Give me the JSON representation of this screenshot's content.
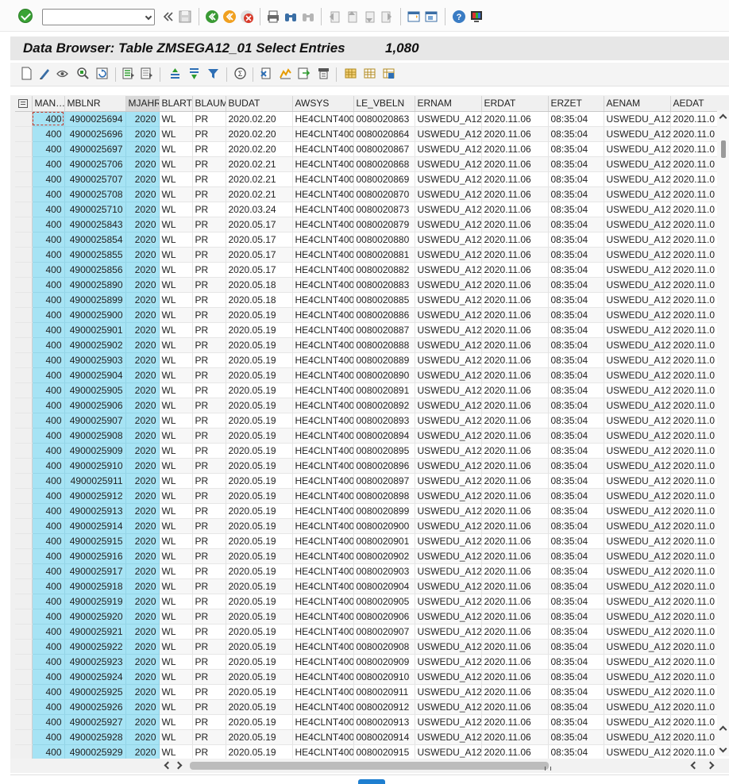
{
  "command_field": {
    "value": ""
  },
  "toolbar_icons": [
    "enter-icon",
    "back-icon",
    "save-icon",
    "back-green-icon",
    "exit-icon",
    "cancel-icon",
    "print-icon",
    "find-icon",
    "find-next-icon",
    "first-page-icon",
    "previous-page-icon",
    "next-page-icon",
    "last-page-icon",
    "create-session-icon",
    "shortcut-icon",
    "help-icon",
    "customize-layout-icon"
  ],
  "title": {
    "text": "Data Browser: Table ZMSEGA12_01 Select Entries",
    "count": "1,080"
  },
  "columns": [
    "MAN…",
    "MBLNR",
    "MJAHR",
    "BLART",
    "BLAUM",
    "BUDAT",
    "AWSYS",
    "LE_VBELN",
    "ERNAM",
    "ERDAT",
    "ERZET",
    "AENAM",
    "AEDAT"
  ],
  "rows": [
    {
      "man": "400",
      "mblnr": "4900025694",
      "mjahr": "2020",
      "blart": "WL",
      "blaum": "PR",
      "budat": "2020.02.20",
      "awsys": "HE4CLNT400",
      "le_vbeln": "0080020863",
      "ernam": "USWEDU_A12",
      "erdat": "2020.11.06",
      "erzet": "08:35:04",
      "aenam": "USWEDU_A12",
      "aedat": "2020.11.0"
    },
    {
      "man": "400",
      "mblnr": "4900025696",
      "mjahr": "2020",
      "blart": "WL",
      "blaum": "PR",
      "budat": "2020.02.20",
      "awsys": "HE4CLNT400",
      "le_vbeln": "0080020864",
      "ernam": "USWEDU_A12",
      "erdat": "2020.11.06",
      "erzet": "08:35:04",
      "aenam": "USWEDU_A12",
      "aedat": "2020.11.0"
    },
    {
      "man": "400",
      "mblnr": "4900025697",
      "mjahr": "2020",
      "blart": "WL",
      "blaum": "PR",
      "budat": "2020.02.20",
      "awsys": "HE4CLNT400",
      "le_vbeln": "0080020867",
      "ernam": "USWEDU_A12",
      "erdat": "2020.11.06",
      "erzet": "08:35:04",
      "aenam": "USWEDU_A12",
      "aedat": "2020.11.0"
    },
    {
      "man": "400",
      "mblnr": "4900025706",
      "mjahr": "2020",
      "blart": "WL",
      "blaum": "PR",
      "budat": "2020.02.21",
      "awsys": "HE4CLNT400",
      "le_vbeln": "0080020868",
      "ernam": "USWEDU_A12",
      "erdat": "2020.11.06",
      "erzet": "08:35:04",
      "aenam": "USWEDU_A12",
      "aedat": "2020.11.0"
    },
    {
      "man": "400",
      "mblnr": "4900025707",
      "mjahr": "2020",
      "blart": "WL",
      "blaum": "PR",
      "budat": "2020.02.21",
      "awsys": "HE4CLNT400",
      "le_vbeln": "0080020869",
      "ernam": "USWEDU_A12",
      "erdat": "2020.11.06",
      "erzet": "08:35:04",
      "aenam": "USWEDU_A12",
      "aedat": "2020.11.0"
    },
    {
      "man": "400",
      "mblnr": "4900025708",
      "mjahr": "2020",
      "blart": "WL",
      "blaum": "PR",
      "budat": "2020.02.21",
      "awsys": "HE4CLNT400",
      "le_vbeln": "0080020870",
      "ernam": "USWEDU_A12",
      "erdat": "2020.11.06",
      "erzet": "08:35:04",
      "aenam": "USWEDU_A12",
      "aedat": "2020.11.0"
    },
    {
      "man": "400",
      "mblnr": "4900025710",
      "mjahr": "2020",
      "blart": "WL",
      "blaum": "PR",
      "budat": "2020.03.24",
      "awsys": "HE4CLNT400",
      "le_vbeln": "0080020873",
      "ernam": "USWEDU_A12",
      "erdat": "2020.11.06",
      "erzet": "08:35:04",
      "aenam": "USWEDU_A12",
      "aedat": "2020.11.0"
    },
    {
      "man": "400",
      "mblnr": "4900025843",
      "mjahr": "2020",
      "blart": "WL",
      "blaum": "PR",
      "budat": "2020.05.17",
      "awsys": "HE4CLNT400",
      "le_vbeln": "0080020879",
      "ernam": "USWEDU_A12",
      "erdat": "2020.11.06",
      "erzet": "08:35:04",
      "aenam": "USWEDU_A12",
      "aedat": "2020.11.0"
    },
    {
      "man": "400",
      "mblnr": "4900025854",
      "mjahr": "2020",
      "blart": "WL",
      "blaum": "PR",
      "budat": "2020.05.17",
      "awsys": "HE4CLNT400",
      "le_vbeln": "0080020880",
      "ernam": "USWEDU_A12",
      "erdat": "2020.11.06",
      "erzet": "08:35:04",
      "aenam": "USWEDU_A12",
      "aedat": "2020.11.0"
    },
    {
      "man": "400",
      "mblnr": "4900025855",
      "mjahr": "2020",
      "blart": "WL",
      "blaum": "PR",
      "budat": "2020.05.17",
      "awsys": "HE4CLNT400",
      "le_vbeln": "0080020881",
      "ernam": "USWEDU_A12",
      "erdat": "2020.11.06",
      "erzet": "08:35:04",
      "aenam": "USWEDU_A12",
      "aedat": "2020.11.0"
    },
    {
      "man": "400",
      "mblnr": "4900025856",
      "mjahr": "2020",
      "blart": "WL",
      "blaum": "PR",
      "budat": "2020.05.17",
      "awsys": "HE4CLNT400",
      "le_vbeln": "0080020882",
      "ernam": "USWEDU_A12",
      "erdat": "2020.11.06",
      "erzet": "08:35:04",
      "aenam": "USWEDU_A12",
      "aedat": "2020.11.0"
    },
    {
      "man": "400",
      "mblnr": "4900025890",
      "mjahr": "2020",
      "blart": "WL",
      "blaum": "PR",
      "budat": "2020.05.18",
      "awsys": "HE4CLNT400",
      "le_vbeln": "0080020883",
      "ernam": "USWEDU_A12",
      "erdat": "2020.11.06",
      "erzet": "08:35:04",
      "aenam": "USWEDU_A12",
      "aedat": "2020.11.0"
    },
    {
      "man": "400",
      "mblnr": "4900025899",
      "mjahr": "2020",
      "blart": "WL",
      "blaum": "PR",
      "budat": "2020.05.18",
      "awsys": "HE4CLNT400",
      "le_vbeln": "0080020885",
      "ernam": "USWEDU_A12",
      "erdat": "2020.11.06",
      "erzet": "08:35:04",
      "aenam": "USWEDU_A12",
      "aedat": "2020.11.0"
    },
    {
      "man": "400",
      "mblnr": "4900025900",
      "mjahr": "2020",
      "blart": "WL",
      "blaum": "PR",
      "budat": "2020.05.19",
      "awsys": "HE4CLNT400",
      "le_vbeln": "0080020886",
      "ernam": "USWEDU_A12",
      "erdat": "2020.11.06",
      "erzet": "08:35:04",
      "aenam": "USWEDU_A12",
      "aedat": "2020.11.0"
    },
    {
      "man": "400",
      "mblnr": "4900025901",
      "mjahr": "2020",
      "blart": "WL",
      "blaum": "PR",
      "budat": "2020.05.19",
      "awsys": "HE4CLNT400",
      "le_vbeln": "0080020887",
      "ernam": "USWEDU_A12",
      "erdat": "2020.11.06",
      "erzet": "08:35:04",
      "aenam": "USWEDU_A12",
      "aedat": "2020.11.0"
    },
    {
      "man": "400",
      "mblnr": "4900025902",
      "mjahr": "2020",
      "blart": "WL",
      "blaum": "PR",
      "budat": "2020.05.19",
      "awsys": "HE4CLNT400",
      "le_vbeln": "0080020888",
      "ernam": "USWEDU_A12",
      "erdat": "2020.11.06",
      "erzet": "08:35:04",
      "aenam": "USWEDU_A12",
      "aedat": "2020.11.0"
    },
    {
      "man": "400",
      "mblnr": "4900025903",
      "mjahr": "2020",
      "blart": "WL",
      "blaum": "PR",
      "budat": "2020.05.19",
      "awsys": "HE4CLNT400",
      "le_vbeln": "0080020889",
      "ernam": "USWEDU_A12",
      "erdat": "2020.11.06",
      "erzet": "08:35:04",
      "aenam": "USWEDU_A12",
      "aedat": "2020.11.0"
    },
    {
      "man": "400",
      "mblnr": "4900025904",
      "mjahr": "2020",
      "blart": "WL",
      "blaum": "PR",
      "budat": "2020.05.19",
      "awsys": "HE4CLNT400",
      "le_vbeln": "0080020890",
      "ernam": "USWEDU_A12",
      "erdat": "2020.11.06",
      "erzet": "08:35:04",
      "aenam": "USWEDU_A12",
      "aedat": "2020.11.0"
    },
    {
      "man": "400",
      "mblnr": "4900025905",
      "mjahr": "2020",
      "blart": "WL",
      "blaum": "PR",
      "budat": "2020.05.19",
      "awsys": "HE4CLNT400",
      "le_vbeln": "0080020891",
      "ernam": "USWEDU_A12",
      "erdat": "2020.11.06",
      "erzet": "08:35:04",
      "aenam": "USWEDU_A12",
      "aedat": "2020.11.0"
    },
    {
      "man": "400",
      "mblnr": "4900025906",
      "mjahr": "2020",
      "blart": "WL",
      "blaum": "PR",
      "budat": "2020.05.19",
      "awsys": "HE4CLNT400",
      "le_vbeln": "0080020892",
      "ernam": "USWEDU_A12",
      "erdat": "2020.11.06",
      "erzet": "08:35:04",
      "aenam": "USWEDU_A12",
      "aedat": "2020.11.0"
    },
    {
      "man": "400",
      "mblnr": "4900025907",
      "mjahr": "2020",
      "blart": "WL",
      "blaum": "PR",
      "budat": "2020.05.19",
      "awsys": "HE4CLNT400",
      "le_vbeln": "0080020893",
      "ernam": "USWEDU_A12",
      "erdat": "2020.11.06",
      "erzet": "08:35:04",
      "aenam": "USWEDU_A12",
      "aedat": "2020.11.0"
    },
    {
      "man": "400",
      "mblnr": "4900025908",
      "mjahr": "2020",
      "blart": "WL",
      "blaum": "PR",
      "budat": "2020.05.19",
      "awsys": "HE4CLNT400",
      "le_vbeln": "0080020894",
      "ernam": "USWEDU_A12",
      "erdat": "2020.11.06",
      "erzet": "08:35:04",
      "aenam": "USWEDU_A12",
      "aedat": "2020.11.0"
    },
    {
      "man": "400",
      "mblnr": "4900025909",
      "mjahr": "2020",
      "blart": "WL",
      "blaum": "PR",
      "budat": "2020.05.19",
      "awsys": "HE4CLNT400",
      "le_vbeln": "0080020895",
      "ernam": "USWEDU_A12",
      "erdat": "2020.11.06",
      "erzet": "08:35:04",
      "aenam": "USWEDU_A12",
      "aedat": "2020.11.0"
    },
    {
      "man": "400",
      "mblnr": "4900025910",
      "mjahr": "2020",
      "blart": "WL",
      "blaum": "PR",
      "budat": "2020.05.19",
      "awsys": "HE4CLNT400",
      "le_vbeln": "0080020896",
      "ernam": "USWEDU_A12",
      "erdat": "2020.11.06",
      "erzet": "08:35:04",
      "aenam": "USWEDU_A12",
      "aedat": "2020.11.0"
    },
    {
      "man": "400",
      "mblnr": "4900025911",
      "mjahr": "2020",
      "blart": "WL",
      "blaum": "PR",
      "budat": "2020.05.19",
      "awsys": "HE4CLNT400",
      "le_vbeln": "0080020897",
      "ernam": "USWEDU_A12",
      "erdat": "2020.11.06",
      "erzet": "08:35:04",
      "aenam": "USWEDU_A12",
      "aedat": "2020.11.0"
    },
    {
      "man": "400",
      "mblnr": "4900025912",
      "mjahr": "2020",
      "blart": "WL",
      "blaum": "PR",
      "budat": "2020.05.19",
      "awsys": "HE4CLNT400",
      "le_vbeln": "0080020898",
      "ernam": "USWEDU_A12",
      "erdat": "2020.11.06",
      "erzet": "08:35:04",
      "aenam": "USWEDU_A12",
      "aedat": "2020.11.0"
    },
    {
      "man": "400",
      "mblnr": "4900025913",
      "mjahr": "2020",
      "blart": "WL",
      "blaum": "PR",
      "budat": "2020.05.19",
      "awsys": "HE4CLNT400",
      "le_vbeln": "0080020899",
      "ernam": "USWEDU_A12",
      "erdat": "2020.11.06",
      "erzet": "08:35:04",
      "aenam": "USWEDU_A12",
      "aedat": "2020.11.0"
    },
    {
      "man": "400",
      "mblnr": "4900025914",
      "mjahr": "2020",
      "blart": "WL",
      "blaum": "PR",
      "budat": "2020.05.19",
      "awsys": "HE4CLNT400",
      "le_vbeln": "0080020900",
      "ernam": "USWEDU_A12",
      "erdat": "2020.11.06",
      "erzet": "08:35:04",
      "aenam": "USWEDU_A12",
      "aedat": "2020.11.0"
    },
    {
      "man": "400",
      "mblnr": "4900025915",
      "mjahr": "2020",
      "blart": "WL",
      "blaum": "PR",
      "budat": "2020.05.19",
      "awsys": "HE4CLNT400",
      "le_vbeln": "0080020901",
      "ernam": "USWEDU_A12",
      "erdat": "2020.11.06",
      "erzet": "08:35:04",
      "aenam": "USWEDU_A12",
      "aedat": "2020.11.0"
    },
    {
      "man": "400",
      "mblnr": "4900025916",
      "mjahr": "2020",
      "blart": "WL",
      "blaum": "PR",
      "budat": "2020.05.19",
      "awsys": "HE4CLNT400",
      "le_vbeln": "0080020902",
      "ernam": "USWEDU_A12",
      "erdat": "2020.11.06",
      "erzet": "08:35:04",
      "aenam": "USWEDU_A12",
      "aedat": "2020.11.0"
    },
    {
      "man": "400",
      "mblnr": "4900025917",
      "mjahr": "2020",
      "blart": "WL",
      "blaum": "PR",
      "budat": "2020.05.19",
      "awsys": "HE4CLNT400",
      "le_vbeln": "0080020903",
      "ernam": "USWEDU_A12",
      "erdat": "2020.11.06",
      "erzet": "08:35:04",
      "aenam": "USWEDU_A12",
      "aedat": "2020.11.0"
    },
    {
      "man": "400",
      "mblnr": "4900025918",
      "mjahr": "2020",
      "blart": "WL",
      "blaum": "PR",
      "budat": "2020.05.19",
      "awsys": "HE4CLNT400",
      "le_vbeln": "0080020904",
      "ernam": "USWEDU_A12",
      "erdat": "2020.11.06",
      "erzet": "08:35:04",
      "aenam": "USWEDU_A12",
      "aedat": "2020.11.0"
    },
    {
      "man": "400",
      "mblnr": "4900025919",
      "mjahr": "2020",
      "blart": "WL",
      "blaum": "PR",
      "budat": "2020.05.19",
      "awsys": "HE4CLNT400",
      "le_vbeln": "0080020905",
      "ernam": "USWEDU_A12",
      "erdat": "2020.11.06",
      "erzet": "08:35:04",
      "aenam": "USWEDU_A12",
      "aedat": "2020.11.0"
    },
    {
      "man": "400",
      "mblnr": "4900025920",
      "mjahr": "2020",
      "blart": "WL",
      "blaum": "PR",
      "budat": "2020.05.19",
      "awsys": "HE4CLNT400",
      "le_vbeln": "0080020906",
      "ernam": "USWEDU_A12",
      "erdat": "2020.11.06",
      "erzet": "08:35:04",
      "aenam": "USWEDU_A12",
      "aedat": "2020.11.0"
    },
    {
      "man": "400",
      "mblnr": "4900025921",
      "mjahr": "2020",
      "blart": "WL",
      "blaum": "PR",
      "budat": "2020.05.19",
      "awsys": "HE4CLNT400",
      "le_vbeln": "0080020907",
      "ernam": "USWEDU_A12",
      "erdat": "2020.11.06",
      "erzet": "08:35:04",
      "aenam": "USWEDU_A12",
      "aedat": "2020.11.0"
    },
    {
      "man": "400",
      "mblnr": "4900025922",
      "mjahr": "2020",
      "blart": "WL",
      "blaum": "PR",
      "budat": "2020.05.19",
      "awsys": "HE4CLNT400",
      "le_vbeln": "0080020908",
      "ernam": "USWEDU_A12",
      "erdat": "2020.11.06",
      "erzet": "08:35:04",
      "aenam": "USWEDU_A12",
      "aedat": "2020.11.0"
    },
    {
      "man": "400",
      "mblnr": "4900025923",
      "mjahr": "2020",
      "blart": "WL",
      "blaum": "PR",
      "budat": "2020.05.19",
      "awsys": "HE4CLNT400",
      "le_vbeln": "0080020909",
      "ernam": "USWEDU_A12",
      "erdat": "2020.11.06",
      "erzet": "08:35:04",
      "aenam": "USWEDU_A12",
      "aedat": "2020.11.0"
    },
    {
      "man": "400",
      "mblnr": "4900025924",
      "mjahr": "2020",
      "blart": "WL",
      "blaum": "PR",
      "budat": "2020.05.19",
      "awsys": "HE4CLNT400",
      "le_vbeln": "0080020910",
      "ernam": "USWEDU_A12",
      "erdat": "2020.11.06",
      "erzet": "08:35:04",
      "aenam": "USWEDU_A12",
      "aedat": "2020.11.0"
    },
    {
      "man": "400",
      "mblnr": "4900025925",
      "mjahr": "2020",
      "blart": "WL",
      "blaum": "PR",
      "budat": "2020.05.19",
      "awsys": "HE4CLNT400",
      "le_vbeln": "0080020911",
      "ernam": "USWEDU_A12",
      "erdat": "2020.11.06",
      "erzet": "08:35:04",
      "aenam": "USWEDU_A12",
      "aedat": "2020.11.0"
    },
    {
      "man": "400",
      "mblnr": "4900025926",
      "mjahr": "2020",
      "blart": "WL",
      "blaum": "PR",
      "budat": "2020.05.19",
      "awsys": "HE4CLNT400",
      "le_vbeln": "0080020912",
      "ernam": "USWEDU_A12",
      "erdat": "2020.11.06",
      "erzet": "08:35:04",
      "aenam": "USWEDU_A12",
      "aedat": "2020.11.0"
    },
    {
      "man": "400",
      "mblnr": "4900025927",
      "mjahr": "2020",
      "blart": "WL",
      "blaum": "PR",
      "budat": "2020.05.19",
      "awsys": "HE4CLNT400",
      "le_vbeln": "0080020913",
      "ernam": "USWEDU_A12",
      "erdat": "2020.11.06",
      "erzet": "08:35:04",
      "aenam": "USWEDU_A12",
      "aedat": "2020.11.0"
    },
    {
      "man": "400",
      "mblnr": "4900025928",
      "mjahr": "2020",
      "blart": "WL",
      "blaum": "PR",
      "budat": "2020.05.19",
      "awsys": "HE4CLNT400",
      "le_vbeln": "0080020914",
      "ernam": "USWEDU_A12",
      "erdat": "2020.11.06",
      "erzet": "08:35:04",
      "aenam": "USWEDU_A12",
      "aedat": "2020.11.0"
    },
    {
      "man": "400",
      "mblnr": "4900025929",
      "mjahr": "2020",
      "blart": "WL",
      "blaum": "PR",
      "budat": "2020.05.19",
      "awsys": "HE4CLNT400",
      "le_vbeln": "0080020915",
      "ernam": "USWEDU_A12",
      "erdat": "2020.11.06",
      "erzet": "08:35:04",
      "aenam": "USWEDU_A12",
      "aedat": "2020.11.0"
    }
  ],
  "colors": {
    "key_column": "#a6e3f4",
    "title_bar": "#e7e7e7",
    "ok_green": "#3aa335"
  }
}
